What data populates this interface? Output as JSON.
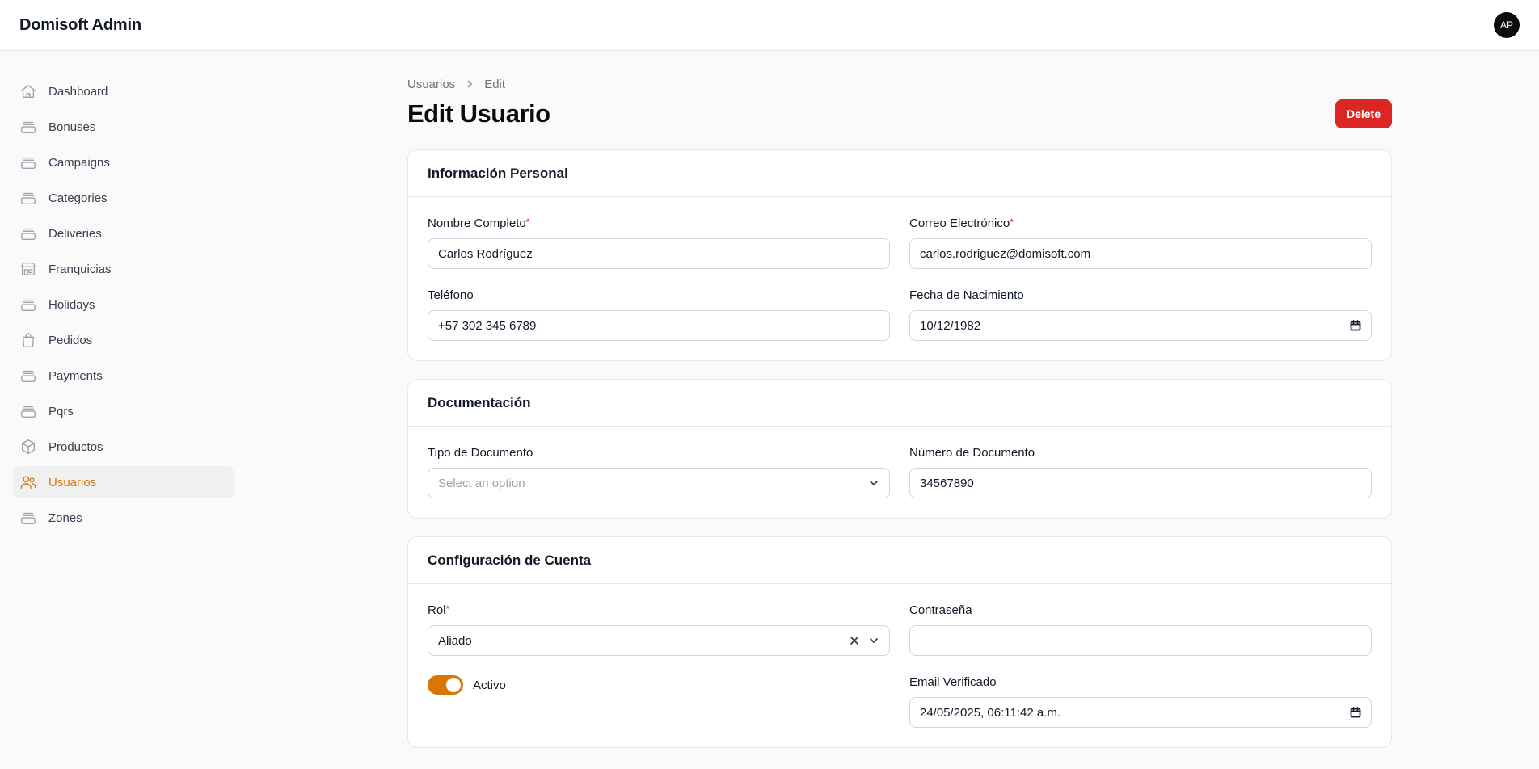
{
  "app": {
    "title": "Domisoft Admin",
    "avatar_initials": "AP"
  },
  "sidebar": {
    "items": [
      {
        "label": "Dashboard",
        "icon": "home-icon",
        "active": false
      },
      {
        "label": "Bonuses",
        "icon": "stack-icon",
        "active": false
      },
      {
        "label": "Campaigns",
        "icon": "stack-icon",
        "active": false
      },
      {
        "label": "Categories",
        "icon": "stack-icon",
        "active": false
      },
      {
        "label": "Deliveries",
        "icon": "stack-icon",
        "active": false
      },
      {
        "label": "Franquicias",
        "icon": "storefront-icon",
        "active": false
      },
      {
        "label": "Holidays",
        "icon": "stack-icon",
        "active": false
      },
      {
        "label": "Pedidos",
        "icon": "shopping-bag-icon",
        "active": false
      },
      {
        "label": "Payments",
        "icon": "stack-icon",
        "active": false
      },
      {
        "label": "Pqrs",
        "icon": "stack-icon",
        "active": false
      },
      {
        "label": "Productos",
        "icon": "cube-icon",
        "active": false
      },
      {
        "label": "Usuarios",
        "icon": "users-icon",
        "active": true
      },
      {
        "label": "Zones",
        "icon": "stack-icon",
        "active": false
      }
    ]
  },
  "breadcrumb": {
    "parent": "Usuarios",
    "current": "Edit"
  },
  "page": {
    "title": "Edit Usuario",
    "delete_label": "Delete"
  },
  "sections": {
    "personal": {
      "title": "Información Personal",
      "nombre": {
        "label": "Nombre Completo",
        "value": "Carlos Rodríguez",
        "required": "*"
      },
      "correo": {
        "label": "Correo Electrónico",
        "value": "carlos.rodriguez@domisoft.com",
        "required": "*"
      },
      "telefono": {
        "label": "Teléfono",
        "value": "+57 302 345 6789"
      },
      "nacimiento": {
        "label": "Fecha de Nacimiento",
        "value": "10/12/1982"
      }
    },
    "documentacion": {
      "title": "Documentación",
      "tipo": {
        "label": "Tipo de Documento",
        "placeholder": "Select an option"
      },
      "numero": {
        "label": "Número de Documento",
        "value": "34567890"
      }
    },
    "cuenta": {
      "title": "Configuración de Cuenta",
      "rol": {
        "label": "Rol",
        "value": "Aliado",
        "required": "*"
      },
      "contrasena": {
        "label": "Contraseña",
        "value": ""
      },
      "activo": {
        "label": "Activo",
        "on": true
      },
      "email_verificado": {
        "label": "Email Verificado",
        "value": "24/05/2025, 06:11:42 a.m."
      }
    }
  },
  "colors": {
    "accent": "#d97706",
    "danger": "#dc2626",
    "border": "#e5e7eb"
  }
}
